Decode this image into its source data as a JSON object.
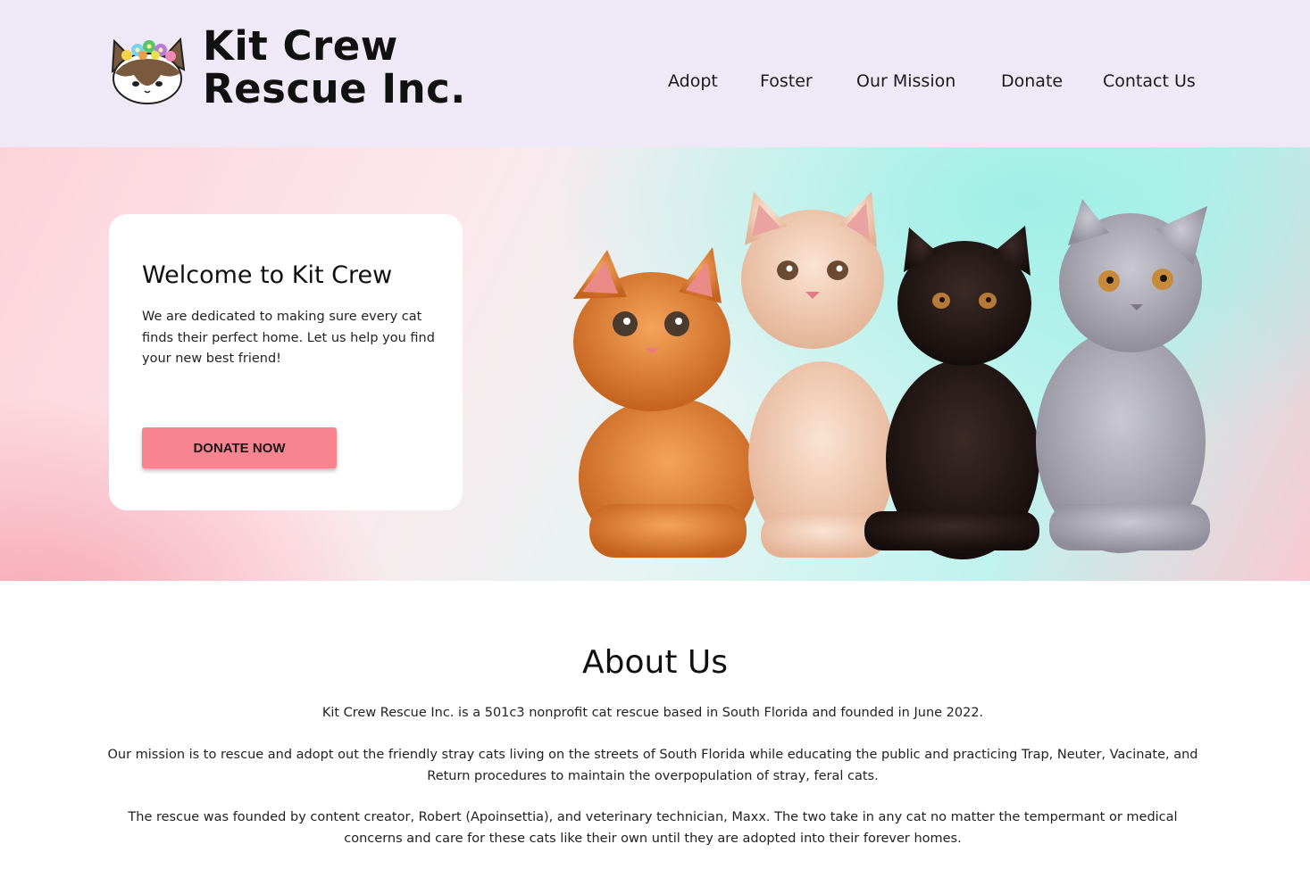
{
  "header": {
    "brand_line1": "Kit Crew",
    "brand_line2": "Rescue Inc.",
    "logo_icon": "cat-flower-crown-icon",
    "nav": [
      {
        "label": "Adopt"
      },
      {
        "label": "Foster"
      },
      {
        "label": "Our Mission"
      },
      {
        "label": "Donate"
      },
      {
        "label": "Contact Us"
      }
    ]
  },
  "hero": {
    "title": "Welcome to Kit Crew",
    "text": "We are dedicated to making sure every cat finds their perfect home. Let us help you find your new best friend!",
    "button_label": "DONATE NOW",
    "image": "four-kittens-photo"
  },
  "about": {
    "title": "About Us",
    "p1": "Kit Crew Rescue Inc. is a 501c3 nonprofit cat rescue based in South Florida and founded in June 2022.",
    "p2": "Our mission is to rescue and adopt out the friendly stray cats living on the streets of South Florida while educating the public and practicing Trap, Neuter, Vacinate, and Return procedures to maintain the overpopulation of stray, feral cats.",
    "p3": "The rescue was founded by content creator, Robert (Apoinsettia), and veterinary technician, Maxx. The two take in any cat no matter the tempermant or medical concerns and care for these cats like their own until they are adopted into their forever homes."
  },
  "colors": {
    "header_bg": "#efe9f7",
    "button": "#f7848f",
    "teal": "#9fefe6",
    "pink": "#f7a9b6"
  }
}
